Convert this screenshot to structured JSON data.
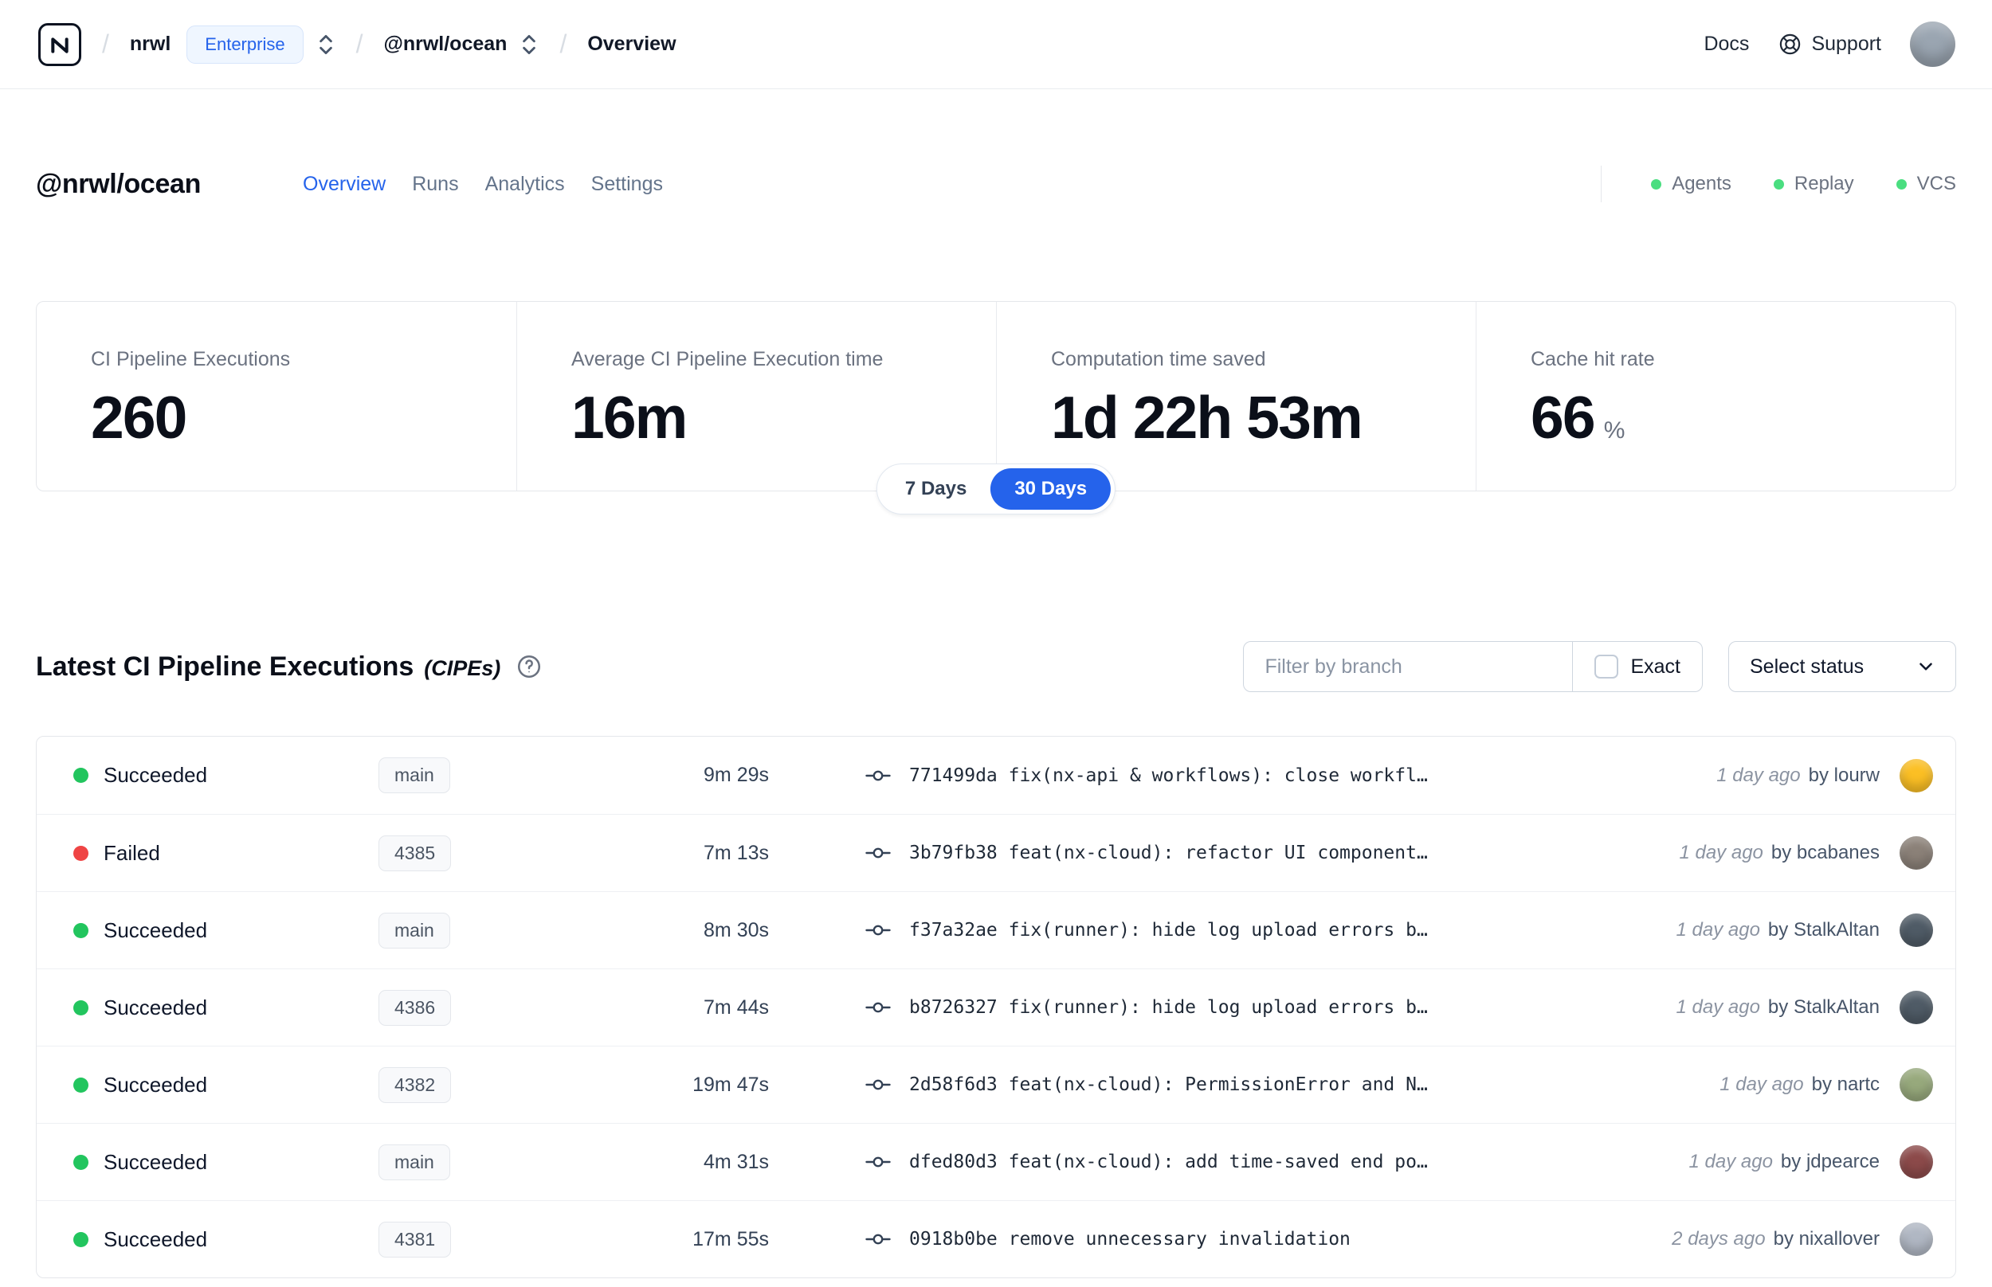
{
  "colors": {
    "accent_blue": "#2563eb",
    "success_green": "#22c55e",
    "failed_red": "#ef4444",
    "indicator_green": "#4ade80"
  },
  "navbar": {
    "separator": "/",
    "org_name": "nrwl",
    "org_badge": "Enterprise",
    "workspace_name": "@nrwl/ocean",
    "page_name": "Overview",
    "docs_label": "Docs",
    "support_label": "Support",
    "avatar_color": "#9aa5b1"
  },
  "workspace_header": {
    "title": "@nrwl/ocean",
    "tabs": [
      {
        "label": "Overview",
        "active": true
      },
      {
        "label": "Runs",
        "active": false
      },
      {
        "label": "Analytics",
        "active": false
      },
      {
        "label": "Settings",
        "active": false
      }
    ],
    "status_indicators": [
      {
        "label": "Agents",
        "dot_color": "#4ade80"
      },
      {
        "label": "Replay",
        "dot_color": "#4ade80"
      },
      {
        "label": "VCS",
        "dot_color": "#4ade80"
      }
    ]
  },
  "stats": {
    "cards": [
      {
        "label": "CI Pipeline Executions",
        "value": "260",
        "suffix": ""
      },
      {
        "label": "Average CI Pipeline Execution time",
        "value": "16m",
        "suffix": ""
      },
      {
        "label": "Computation time saved",
        "value": "1d 22h 53m",
        "suffix": ""
      },
      {
        "label": "Cache hit rate",
        "value": "66",
        "suffix": "%"
      }
    ],
    "range_toggle": {
      "options": [
        "7 Days",
        "30 Days"
      ],
      "selected": "30 Days"
    }
  },
  "cipes": {
    "title": "Latest CI Pipeline Executions",
    "title_suffix": "(CIPEs)",
    "filter": {
      "placeholder": "Filter by branch",
      "exact_label": "Exact",
      "exact_checked": false,
      "status_select_label": "Select status"
    },
    "rows": [
      {
        "status": "Succeeded",
        "dot_color": "#22c55e",
        "branch": "main",
        "duration": "9m 29s",
        "commit": "771499da fix(nx-api & workflows): close workfl…",
        "time": "1 day ago",
        "author": "by lourw",
        "avatar_color": "#fbbf24"
      },
      {
        "status": "Failed",
        "dot_color": "#ef4444",
        "branch": "4385",
        "duration": "7m 13s",
        "commit": "3b79fb38 feat(nx-cloud): refactor UI component…",
        "time": "1 day ago",
        "author": "by bcabanes",
        "avatar_color": "#8b8178"
      },
      {
        "status": "Succeeded",
        "dot_color": "#22c55e",
        "branch": "main",
        "duration": "8m 30s",
        "commit": "f37a32ae fix(runner): hide log upload errors b…",
        "time": "1 day ago",
        "author": "by StalkAltan",
        "avatar_color": "#4f5b66"
      },
      {
        "status": "Succeeded",
        "dot_color": "#22c55e",
        "branch": "4386",
        "duration": "7m 44s",
        "commit": "b8726327 fix(runner): hide log upload errors b…",
        "time": "1 day ago",
        "author": "by StalkAltan",
        "avatar_color": "#4f5b66"
      },
      {
        "status": "Succeeded",
        "dot_color": "#22c55e",
        "branch": "4382",
        "duration": "19m 47s",
        "commit": "2d58f6d3 feat(nx-cloud): PermissionError and N…",
        "time": "1 day ago",
        "author": "by nartc",
        "avatar_color": "#97a97c"
      },
      {
        "status": "Succeeded",
        "dot_color": "#22c55e",
        "branch": "main",
        "duration": "4m 31s",
        "commit": "dfed80d3 feat(nx-cloud): add time-saved end po…",
        "time": "1 day ago",
        "author": "by jdpearce",
        "avatar_color": "#8c4a4a"
      },
      {
        "status": "Succeeded",
        "dot_color": "#22c55e",
        "branch": "4381",
        "duration": "17m 55s",
        "commit": "0918b0be remove unnecessary invalidation",
        "time": "2 days ago",
        "author": "by nixallover",
        "avatar_color": "#b0b7c3"
      }
    ]
  }
}
